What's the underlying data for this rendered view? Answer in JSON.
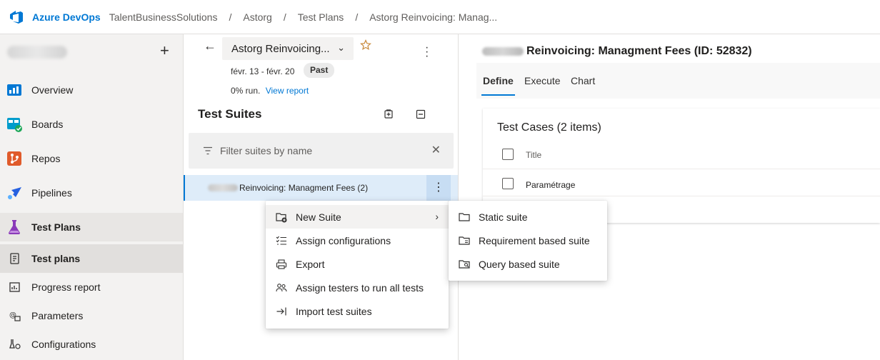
{
  "topbar": {
    "brand": "Azure DevOps",
    "breadcrumbs": [
      "TalentBusinessSolutions",
      "Astorg",
      "Test Plans",
      "Astorg Reinvoicing: Manag..."
    ],
    "separator": "/"
  },
  "sidebar": {
    "add_label": "+",
    "items": [
      {
        "label": "Overview",
        "icon": "overview-icon",
        "color": "#0078d4"
      },
      {
        "label": "Boards",
        "icon": "boards-icon",
        "color": "#009ccc"
      },
      {
        "label": "Repos",
        "icon": "repos-icon",
        "color": "#e05b2b"
      },
      {
        "label": "Pipelines",
        "icon": "pipelines-icon",
        "color": "#2560e0"
      },
      {
        "label": "Test Plans",
        "icon": "test-plans-icon",
        "color": "#8a3ab9"
      },
      {
        "label": "Test plans",
        "icon": "test-plans-sub-icon"
      },
      {
        "label": "Progress report",
        "icon": "progress-report-icon"
      },
      {
        "label": "Parameters",
        "icon": "parameters-icon"
      },
      {
        "label": "Configurations",
        "icon": "configurations-icon"
      }
    ]
  },
  "plan": {
    "back": "←",
    "name": "Astorg Reinvoicing...",
    "dates": "févr. 13 - févr. 20",
    "status": "Past",
    "runs": "0% run.",
    "view_report": "View report"
  },
  "suites": {
    "title": "Test Suites",
    "filter_placeholder": "Filter suites by name",
    "selected_suite": "Reinvoicing: Managment Fees (2)"
  },
  "context_menu": {
    "items": [
      "New Suite",
      "Assign configurations",
      "Export",
      "Assign testers to run all tests",
      "Import test suites"
    ]
  },
  "submenu": {
    "items": [
      "Static suite",
      "Requirement based suite",
      "Query based suite"
    ]
  },
  "detail": {
    "title": "Reinvoicing: Managment Fees (ID: 52832)",
    "tabs": [
      "Define",
      "Execute",
      "Chart"
    ],
    "test_cases_title": "Test Cases (2 items)",
    "column_title": "Title",
    "rows": [
      "Paramétrage"
    ]
  },
  "colors": {
    "accent": "#0078d4",
    "selected_bg": "#deecf9",
    "nav_bg": "#f3f2f1"
  }
}
